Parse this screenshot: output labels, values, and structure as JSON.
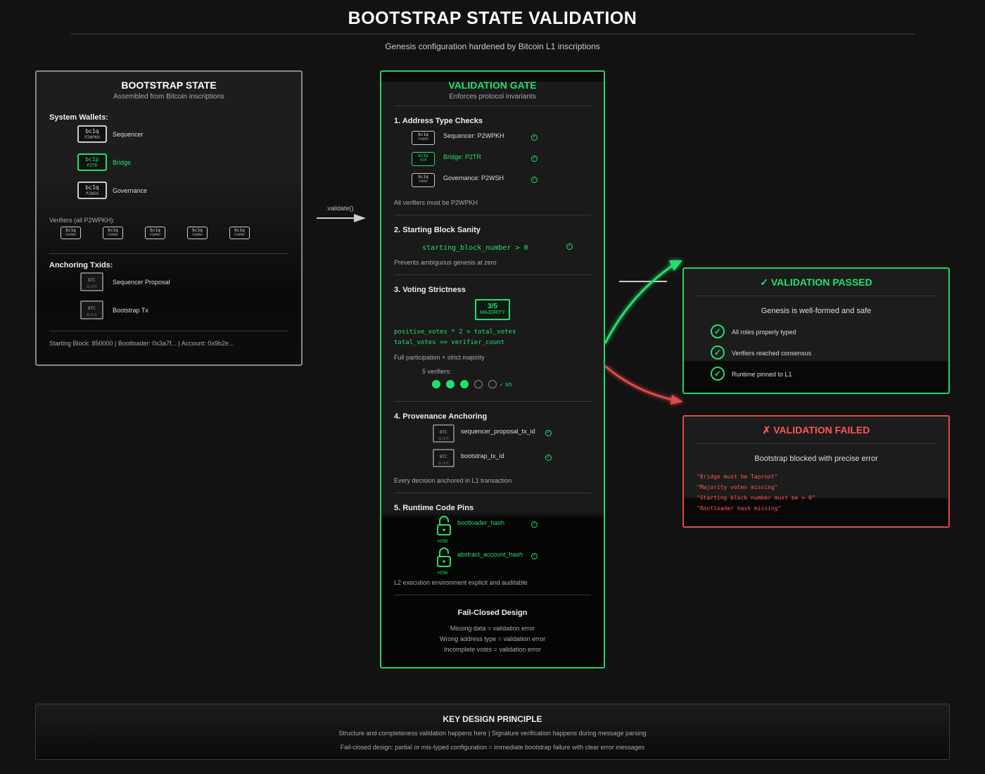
{
  "header": {
    "title": "BOOTSTRAP STATE VALIDATION",
    "subtitle": "Genesis configuration hardened by Bitcoin L1 inscriptions"
  },
  "colors": {
    "accent_green": "#22e06a",
    "fail_red": "#e04848",
    "background": "#121212"
  },
  "bootstrap": {
    "title": "BOOTSTRAP STATE",
    "subtitle": "Assembled from Bitcoin inscriptions",
    "wallets_label": "System Wallets:",
    "wallets": [
      {
        "chip_top": "bc1q",
        "chip_bottom": "P2WPKH",
        "label": "Sequencer",
        "highlight": false
      },
      {
        "chip_top": "bc1p",
        "chip_bottom": "P2TR",
        "label": "Bridge",
        "highlight": true
      },
      {
        "chip_top": "bc1q",
        "chip_bottom": "P2WSH",
        "label": "Governance",
        "highlight": false
      }
    ],
    "verifiers_label": "Verifiers (all P2WPKH):",
    "verifiers": [
      {
        "chip_top": "bc1q",
        "chip_bottom": "P2WPKH"
      },
      {
        "chip_top": "bc1q",
        "chip_bottom": "P2WPKH"
      },
      {
        "chip_top": "bc1q",
        "chip_bottom": "P2WPKH"
      },
      {
        "chip_top": "bc1q",
        "chip_bottom": "P2WPKH"
      },
      {
        "chip_top": "bc1q",
        "chip_bottom": "P2WPKH"
      }
    ],
    "anchoring_label": "Anchoring Txids:",
    "anchors": [
      {
        "top": "BTC",
        "bottom": "BLOCK",
        "label": "Sequencer Proposal"
      },
      {
        "top": "BTC",
        "bottom": "BLOCK",
        "label": "Bootstrap Tx"
      }
    ],
    "footer": "Starting Block: 850000 | Bootloader: 0x3a7f... | Account: 0x9b2e..."
  },
  "arrow_label": ".validate()",
  "gate": {
    "title": "VALIDATION GATE",
    "subtitle": "Enforces protocol invariants",
    "s1": {
      "title": "1. Address Type Checks",
      "items": [
        {
          "chip_top": "bc1q",
          "chip_bottom": "P2WPKH",
          "label": "Sequencer: P2WPKH",
          "highlight": false
        },
        {
          "chip_top": "bc1p",
          "chip_bottom": "P2TR",
          "label": "Bridge: P2TR",
          "highlight": true
        },
        {
          "chip_top": "bc1q",
          "chip_bottom": "P2WSH",
          "label": "Governance: P2WSH",
          "highlight": false
        }
      ],
      "note": "All verifiers must be P2WPKH"
    },
    "s2": {
      "title": "2. Starting Block Sanity",
      "code": "starting_block_number > 0",
      "note": "Prevents ambiguous genesis at zero"
    },
    "s3": {
      "title": "3. Voting Strictness",
      "badge_value": "3/5",
      "badge_label": "MAJORITY",
      "code1": "positive_votes * 2 > total_votes",
      "code2": "total_votes == verifier_count",
      "note": "Full participation + strict majority",
      "verifiers_label": "5 verifiers:",
      "votes": [
        true,
        true,
        true,
        false,
        false
      ],
      "votes_summary": "✓ 3/5"
    },
    "s4": {
      "title": "4. Provenance Anchoring",
      "items": [
        {
          "top": "BTC",
          "bottom": "BLOCK",
          "label": "sequencer_proposal_tx_id"
        },
        {
          "top": "BTC",
          "bottom": "BLOCK",
          "label": "bootstrap_tx_id"
        }
      ],
      "note": "Every decision anchored in L1 transaction"
    },
    "s5": {
      "title": "5. Runtime Code Pins",
      "items": [
        {
          "label": "bootloader_hash",
          "lock_caption": "H256"
        },
        {
          "label": "abstract_account_hash",
          "lock_caption": "H256"
        }
      ],
      "note": "L2 execution environment explicit and auditable"
    },
    "failclosed": {
      "title": "Fail-Closed Design",
      "lines": [
        "Missing data = validation error",
        "Wrong address type = validation error",
        "Incomplete votes = validation error"
      ]
    }
  },
  "passed": {
    "title": "✓ VALIDATION PASSED",
    "subtitle": "Genesis is well-formed and safe",
    "items": [
      "All roles properly typed",
      "Verifiers reached consensus",
      "Runtime pinned to L1"
    ]
  },
  "failed": {
    "title": "✗ VALIDATION FAILED",
    "subtitle": "Bootstrap blocked with precise error",
    "errors": [
      "\"Bridge must be Taproot\"",
      "\"Majority votes missing\"",
      "\"Starting block number must be > 0\"",
      "\"Bootloader hash missing\""
    ]
  },
  "key": {
    "title": "KEY DESIGN PRINCIPLE",
    "line1": "Structure and completeness validation happens here | Signature verification happens during message parsing",
    "line2": "Fail-closed design: partial or mis-typed configuration = immediate bootstrap failure with clear error messages"
  }
}
